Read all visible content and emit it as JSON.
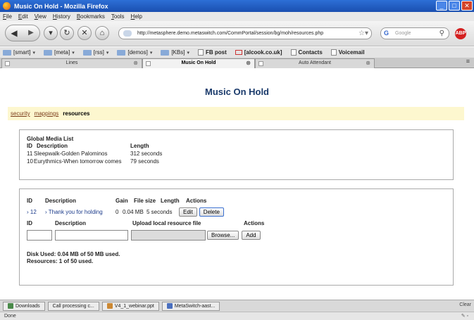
{
  "window": {
    "title": "Music On Hold - Mozilla Firefox"
  },
  "menu": [
    "File",
    "Edit",
    "View",
    "History",
    "Bookmarks",
    "Tools",
    "Help"
  ],
  "nav": {
    "url": "http://metasphere.demo.metaswitch.com/CommPortal/session/bg/moh/resources.php",
    "search_placeholder": "Google"
  },
  "bookmarks": [
    {
      "label": "[smart]",
      "kind": "folder",
      "dropdown": true
    },
    {
      "label": "[meta]",
      "kind": "folder",
      "dropdown": true
    },
    {
      "label": "[rss]",
      "kind": "folder",
      "dropdown": true
    },
    {
      "label": "[demos]",
      "kind": "folder",
      "dropdown": true
    },
    {
      "label": "[KBs]",
      "kind": "folder",
      "dropdown": true
    },
    {
      "label": "FB post",
      "kind": "page",
      "dropdown": false
    },
    {
      "label": "[alcook.co.uk]",
      "kind": "mail",
      "dropdown": false
    },
    {
      "label": "Contacts",
      "kind": "page",
      "dropdown": false
    },
    {
      "label": "Voicemail",
      "kind": "page",
      "dropdown": false
    }
  ],
  "tabs": [
    {
      "label": "Lines",
      "active": false
    },
    {
      "label": "Music On Hold",
      "active": true
    },
    {
      "label": "Auto Attendant",
      "active": false
    }
  ],
  "page": {
    "title": "Music On Hold",
    "subnav": {
      "security": "security",
      "mappings": "mappings",
      "resources": "resources"
    },
    "global_media": {
      "heading": "Global Media List",
      "col_id": "ID",
      "col_desc": "Description",
      "col_length": "Length",
      "rows": [
        {
          "id": "11",
          "desc": "Sleepwalk-Golden Palominos",
          "length": "312 seconds"
        },
        {
          "id": "10",
          "desc": "Eurythmics-When tomorrow comes",
          "length": "79 seconds"
        }
      ]
    },
    "resources": {
      "col_id": "ID",
      "col_desc": "Description",
      "col_gain": "Gain",
      "col_filesize": "File size",
      "col_length": "Length",
      "col_actions": "Actions",
      "row": {
        "id": "12",
        "desc": "Thank you for holding",
        "gain": "0",
        "filesize": "0.04 MB",
        "length": "5 seconds",
        "edit": "Edit",
        "delete": "Delete"
      },
      "upload": {
        "col_id": "ID",
        "col_desc": "Description",
        "col_file": "Upload local resource file",
        "col_actions": "Actions",
        "browse": "Browse...",
        "add": "Add"
      },
      "disk_used": "Disk Used: 0.04 MB of 50 MB used.",
      "resource_count": "Resources: 1 of 50 used."
    }
  },
  "taskbar": {
    "items": [
      "Downloads",
      "Call processing c...",
      "V4_1_webinar.ppt",
      "MetaSwitch-aast..."
    ],
    "clear": "Clear"
  },
  "status": "Done"
}
